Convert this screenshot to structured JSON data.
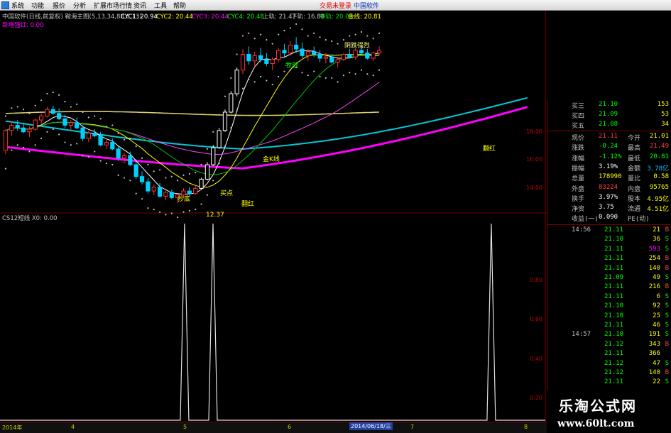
{
  "menu": {
    "items": [
      "系统",
      "功能",
      "报价",
      "分析",
      "扩展市场行情",
      "资讯",
      "工具",
      "帮助"
    ],
    "login_prompt": "交易未登录",
    "brand": "中国软件"
  },
  "main_chart": {
    "title": "中国软件(日线,前复权) 鞍海主图(5,13,34,88,6,13)",
    "indicators": [
      {
        "name": "CYC1",
        "value": "20.94",
        "color": "#ffffff"
      },
      {
        "name": "CYC2",
        "value": "20.44",
        "color": "#ffff00"
      },
      {
        "name": "CYC3",
        "value": "20.44",
        "color": "#ff00ff"
      },
      {
        "name": "CYC4",
        "value": "20.48",
        "color": "#00ff00"
      },
      {
        "name": "上轨",
        "value": "21.47",
        "color": "#c0c0c0"
      },
      {
        "name": "下轨",
        "value": "16.88",
        "color": "#c0c0c0"
      },
      {
        "name": "中轨",
        "value": "20.07",
        "color": "#00e000"
      },
      {
        "name": "金线",
        "value": "20.81",
        "color": "#ffff00"
      }
    ],
    "sub_label": "新增强红: 0.00",
    "price_ticks": [
      "18.00",
      "16.00",
      "14.00"
    ],
    "annotations": [
      "阴跌强烈",
      "牧驯",
      "金K线",
      "买点",
      "抄底",
      "翻红",
      "12.37",
      "翻红"
    ],
    "candles": [
      [
        13.5,
        15.1,
        13.2,
        15.0
      ],
      [
        15.0,
        15.7,
        14.6,
        15.4
      ],
      [
        15.4,
        15.8,
        15.0,
        15.2
      ],
      [
        15.2,
        15.6,
        14.8,
        14.9
      ],
      [
        14.9,
        15.3,
        14.5,
        15.1
      ],
      [
        15.1,
        15.9,
        15.0,
        15.8
      ],
      [
        15.8,
        16.3,
        15.5,
        16.1
      ],
      [
        16.1,
        16.8,
        16.0,
        16.6
      ],
      [
        16.6,
        16.9,
        16.2,
        16.3
      ],
      [
        16.3,
        16.7,
        15.8,
        15.9
      ],
      [
        15.9,
        16.2,
        15.2,
        15.4
      ],
      [
        15.4,
        15.8,
        15.0,
        15.6
      ],
      [
        15.6,
        16.0,
        15.1,
        15.2
      ],
      [
        15.2,
        15.4,
        14.2,
        14.4
      ],
      [
        14.4,
        15.0,
        14.1,
        14.8
      ],
      [
        14.8,
        15.1,
        14.5,
        14.6
      ],
      [
        14.6,
        14.9,
        13.8,
        13.9
      ],
      [
        13.9,
        14.3,
        13.6,
        14.1
      ],
      [
        14.1,
        14.4,
        13.5,
        13.6
      ],
      [
        13.6,
        13.8,
        12.7,
        12.9
      ],
      [
        12.9,
        13.3,
        12.5,
        13.1
      ],
      [
        13.1,
        13.4,
        12.3,
        12.4
      ],
      [
        12.4,
        12.8,
        11.3,
        11.5
      ],
      [
        11.5,
        11.9,
        10.9,
        11.1
      ],
      [
        11.1,
        11.4,
        10.2,
        10.4
      ],
      [
        10.4,
        10.9,
        10.1,
        10.7
      ],
      [
        10.7,
        11.0,
        9.9,
        10.0
      ],
      [
        10.0,
        10.4,
        9.7,
        10.3
      ],
      [
        10.3,
        10.5,
        9.8,
        9.9
      ],
      [
        9.9,
        10.2,
        9.5,
        10.1
      ],
      [
        10.1,
        10.6,
        9.9,
        10.4
      ],
      [
        10.4,
        10.7,
        10.0,
        10.2
      ],
      [
        10.2,
        10.8,
        10.1,
        10.6
      ],
      [
        10.6,
        11.4,
        10.5,
        11.3
      ],
      [
        11.3,
        12.6,
        11.2,
        12.4
      ],
      [
        12.4,
        13.9,
        12.3,
        13.7
      ],
      [
        13.7,
        15.2,
        13.6,
        15.0
      ],
      [
        15.0,
        16.6,
        14.9,
        16.4
      ],
      [
        16.4,
        18.0,
        16.3,
        17.8
      ],
      [
        17.8,
        19.8,
        17.6,
        19.6
      ],
      [
        19.6,
        21.2,
        19.3,
        20.8
      ],
      [
        20.8,
        21.4,
        20.0,
        20.3
      ],
      [
        20.3,
        21.0,
        19.8,
        20.7
      ],
      [
        20.7,
        21.3,
        20.2,
        20.4
      ],
      [
        20.4,
        20.9,
        19.9,
        20.1
      ],
      [
        20.1,
        20.6,
        19.6,
        20.4
      ],
      [
        20.4,
        21.3,
        20.2,
        21.1
      ],
      [
        21.1,
        21.6,
        20.6,
        20.9
      ],
      [
        20.9,
        21.8,
        20.7,
        21.5
      ],
      [
        21.5,
        22.1,
        20.9,
        21.2
      ],
      [
        21.2,
        21.7,
        20.5,
        20.7
      ],
      [
        20.7,
        21.2,
        20.3,
        21.0
      ],
      [
        21.0,
        21.4,
        20.6,
        20.8
      ],
      [
        20.8,
        21.1,
        20.2,
        20.5
      ],
      [
        20.5,
        20.9,
        20.1,
        20.6
      ],
      [
        20.6,
        20.8,
        20.1,
        20.2
      ],
      [
        20.2,
        20.6,
        19.8,
        20.4
      ],
      [
        20.4,
        20.9,
        20.3,
        20.8
      ],
      [
        20.8,
        21.2,
        20.5,
        20.6
      ],
      [
        20.6,
        21.3,
        20.4,
        21.1
      ],
      [
        21.1,
        21.5,
        20.7,
        20.9
      ],
      [
        20.9,
        21.2,
        20.4,
        20.5
      ],
      [
        20.5,
        21.0,
        20.3,
        20.9
      ],
      [
        20.9,
        21.4,
        20.7,
        21.1
      ]
    ]
  },
  "sub_chart": {
    "title": "CS12短线 X0: 0.00",
    "ticks": [
      "0.80",
      "0.60",
      "0.40",
      "0.20"
    ],
    "spike_indices": [
      17,
      20,
      54
    ]
  },
  "status": {
    "dates": [
      "2014年",
      "4",
      "5",
      "6",
      "7",
      "8"
    ],
    "cursor_date": "2014/06/18/三"
  },
  "quote": {
    "asks": [
      {
        "label": "买三",
        "price": "21.10",
        "vol": "153"
      },
      {
        "label": "买四",
        "price": "21.09",
        "vol": "53"
      },
      {
        "label": "买五",
        "price": "21.08",
        "vol": "34"
      }
    ],
    "stats": [
      [
        "现价",
        "21.11",
        "今开",
        "21.01"
      ],
      [
        "涨跌",
        "-0.24",
        "最高",
        "21.49"
      ],
      [
        "涨幅",
        "-1.12%",
        "最低",
        "20.81"
      ],
      [
        "振幅",
        "3.19%",
        "金额",
        "3.78亿"
      ],
      [
        "总量",
        "178990",
        "量比",
        "0.58"
      ],
      [
        "外盘",
        "83224",
        "内盘",
        "95765"
      ],
      [
        "换手",
        "3.97%",
        "股本",
        "4.95亿"
      ],
      [
        "净资",
        "3.75",
        "流通",
        "4.51亿"
      ],
      [
        "收益(一)",
        "0.090",
        "PE(动)",
        ""
      ]
    ],
    "ticks": [
      {
        "time": "14:56",
        "price": "21.11",
        "vol": "21",
        "side": "B"
      },
      {
        "time": "",
        "price": "21.10",
        "vol": "36",
        "side": "S"
      },
      {
        "time": "",
        "price": "21.11",
        "vol": "593",
        "side": "S"
      },
      {
        "time": "",
        "price": "21.11",
        "vol": "254",
        "side": "B"
      },
      {
        "time": "",
        "price": "21.11",
        "vol": "140",
        "side": "B"
      },
      {
        "time": "",
        "price": "21.09",
        "vol": "49",
        "side": "S"
      },
      {
        "time": "",
        "price": "21.11",
        "vol": "216",
        "side": "B"
      },
      {
        "time": "",
        "price": "21.11",
        "vol": "6",
        "side": "S"
      },
      {
        "time": "",
        "price": "21.10",
        "vol": "92",
        "side": "S"
      },
      {
        "time": "",
        "price": "21.10",
        "vol": "25",
        "side": "S"
      },
      {
        "time": "",
        "price": "21.11",
        "vol": "46",
        "side": "S"
      },
      {
        "time": "14:57",
        "price": "21.10",
        "vol": "191",
        "side": "S"
      },
      {
        "time": "",
        "price": "21.12",
        "vol": "343",
        "side": "B"
      },
      {
        "time": "",
        "price": "21.11",
        "vol": "366",
        "side": ""
      },
      {
        "time": "",
        "price": "21.12",
        "vol": "47",
        "side": "S"
      },
      {
        "time": "",
        "price": "21.12",
        "vol": "140",
        "side": "B"
      },
      {
        "time": "",
        "price": "21.11",
        "vol": "22",
        "side": "S"
      }
    ]
  },
  "watermark": {
    "line1": "乐淘公式网",
    "line2": "www.60lt.com"
  }
}
